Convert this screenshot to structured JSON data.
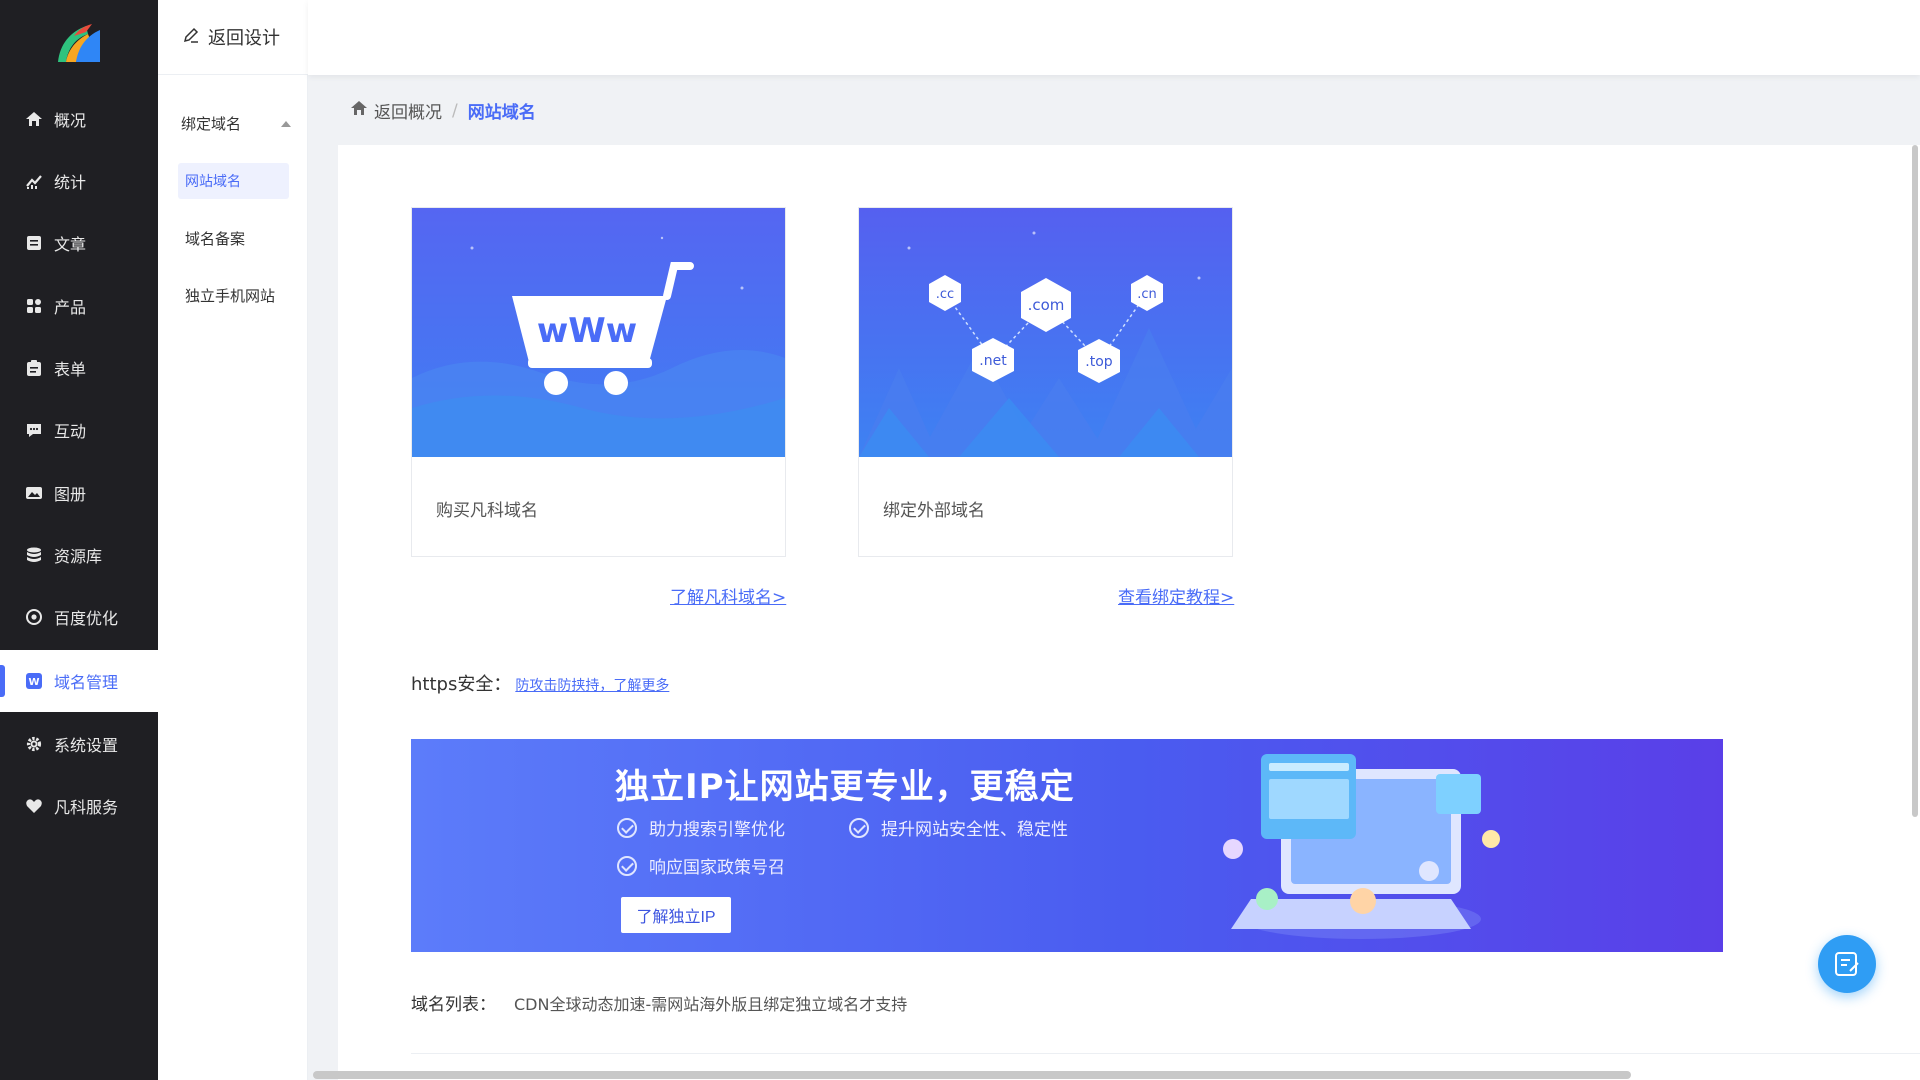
{
  "app": {
    "brand_colors": {
      "accent": "#4a6cf7",
      "sidebar_bg": "#1f1f23",
      "fab": "#2f9df4"
    }
  },
  "sidebar": {
    "items": [
      {
        "label": "概况",
        "icon": "home-icon"
      },
      {
        "label": "统计",
        "icon": "chart-icon"
      },
      {
        "label": "文章",
        "icon": "article-icon"
      },
      {
        "label": "产品",
        "icon": "grid-icon"
      },
      {
        "label": "表单",
        "icon": "clipboard-icon"
      },
      {
        "label": "互动",
        "icon": "chat-icon"
      },
      {
        "label": "图册",
        "icon": "image-icon"
      },
      {
        "label": "资源库",
        "icon": "database-icon"
      },
      {
        "label": "百度优化",
        "icon": "target-icon"
      },
      {
        "label": "域名管理",
        "icon": "w-icon",
        "active": true
      },
      {
        "label": "系统设置",
        "icon": "gear-icon"
      },
      {
        "label": "凡科服务",
        "icon": "heart-icon"
      }
    ]
  },
  "subbar": {
    "back_label": "返回设计",
    "group_label": "绑定域名",
    "items": [
      {
        "label": "网站域名",
        "active": true
      },
      {
        "label": "域名备案"
      },
      {
        "label": "独立手机网站"
      }
    ]
  },
  "breadcrumb": {
    "back": "返回概况",
    "separator": "/",
    "current": "网站域名"
  },
  "tiles": [
    {
      "label": "购买凡科域名",
      "link": "了解凡科域名>",
      "art_text": "wWw"
    },
    {
      "label": "绑定外部域名",
      "link": "查看绑定教程>",
      "tlds": [
        ".cc",
        ".com",
        ".cn",
        ".net",
        ".top"
      ]
    }
  ],
  "https": {
    "label": "https安全：",
    "link": "防攻击防挟持，了解更多"
  },
  "banner": {
    "title": "独立IP让网站更专业，更稳定",
    "features": [
      "助力搜索引擎优化",
      "提升网站安全性、稳定性",
      "响应国家政策号召"
    ],
    "button": "了解独立IP"
  },
  "domain_list": {
    "label": "域名列表：",
    "note": "CDN全球动态加速-需网站海外版且绑定独立域名才支持"
  }
}
